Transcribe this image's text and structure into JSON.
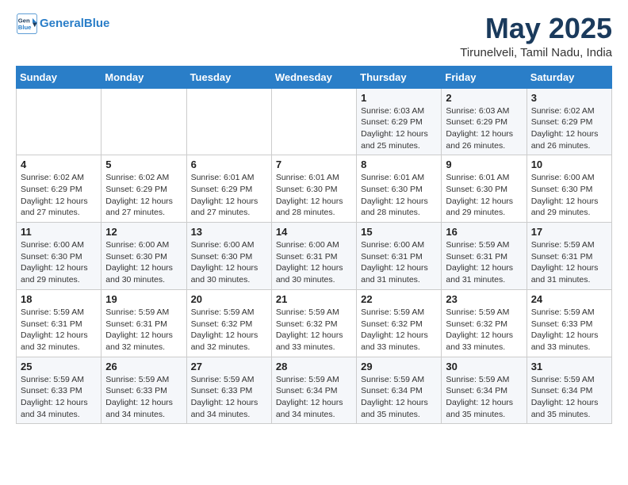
{
  "header": {
    "logo_line1": "General",
    "logo_line2": "Blue",
    "title": "May 2025",
    "subtitle": "Tirunelveli, Tamil Nadu, India"
  },
  "days_of_week": [
    "Sunday",
    "Monday",
    "Tuesday",
    "Wednesday",
    "Thursday",
    "Friday",
    "Saturday"
  ],
  "weeks": [
    [
      {
        "day": "",
        "info": ""
      },
      {
        "day": "",
        "info": ""
      },
      {
        "day": "",
        "info": ""
      },
      {
        "day": "",
        "info": ""
      },
      {
        "day": "1",
        "info": "Sunrise: 6:03 AM\nSunset: 6:29 PM\nDaylight: 12 hours\nand 25 minutes."
      },
      {
        "day": "2",
        "info": "Sunrise: 6:03 AM\nSunset: 6:29 PM\nDaylight: 12 hours\nand 26 minutes."
      },
      {
        "day": "3",
        "info": "Sunrise: 6:02 AM\nSunset: 6:29 PM\nDaylight: 12 hours\nand 26 minutes."
      }
    ],
    [
      {
        "day": "4",
        "info": "Sunrise: 6:02 AM\nSunset: 6:29 PM\nDaylight: 12 hours\nand 27 minutes."
      },
      {
        "day": "5",
        "info": "Sunrise: 6:02 AM\nSunset: 6:29 PM\nDaylight: 12 hours\nand 27 minutes."
      },
      {
        "day": "6",
        "info": "Sunrise: 6:01 AM\nSunset: 6:29 PM\nDaylight: 12 hours\nand 27 minutes."
      },
      {
        "day": "7",
        "info": "Sunrise: 6:01 AM\nSunset: 6:30 PM\nDaylight: 12 hours\nand 28 minutes."
      },
      {
        "day": "8",
        "info": "Sunrise: 6:01 AM\nSunset: 6:30 PM\nDaylight: 12 hours\nand 28 minutes."
      },
      {
        "day": "9",
        "info": "Sunrise: 6:01 AM\nSunset: 6:30 PM\nDaylight: 12 hours\nand 29 minutes."
      },
      {
        "day": "10",
        "info": "Sunrise: 6:00 AM\nSunset: 6:30 PM\nDaylight: 12 hours\nand 29 minutes."
      }
    ],
    [
      {
        "day": "11",
        "info": "Sunrise: 6:00 AM\nSunset: 6:30 PM\nDaylight: 12 hours\nand 29 minutes."
      },
      {
        "day": "12",
        "info": "Sunrise: 6:00 AM\nSunset: 6:30 PM\nDaylight: 12 hours\nand 30 minutes."
      },
      {
        "day": "13",
        "info": "Sunrise: 6:00 AM\nSunset: 6:30 PM\nDaylight: 12 hours\nand 30 minutes."
      },
      {
        "day": "14",
        "info": "Sunrise: 6:00 AM\nSunset: 6:31 PM\nDaylight: 12 hours\nand 30 minutes."
      },
      {
        "day": "15",
        "info": "Sunrise: 6:00 AM\nSunset: 6:31 PM\nDaylight: 12 hours\nand 31 minutes."
      },
      {
        "day": "16",
        "info": "Sunrise: 5:59 AM\nSunset: 6:31 PM\nDaylight: 12 hours\nand 31 minutes."
      },
      {
        "day": "17",
        "info": "Sunrise: 5:59 AM\nSunset: 6:31 PM\nDaylight: 12 hours\nand 31 minutes."
      }
    ],
    [
      {
        "day": "18",
        "info": "Sunrise: 5:59 AM\nSunset: 6:31 PM\nDaylight: 12 hours\nand 32 minutes."
      },
      {
        "day": "19",
        "info": "Sunrise: 5:59 AM\nSunset: 6:31 PM\nDaylight: 12 hours\nand 32 minutes."
      },
      {
        "day": "20",
        "info": "Sunrise: 5:59 AM\nSunset: 6:32 PM\nDaylight: 12 hours\nand 32 minutes."
      },
      {
        "day": "21",
        "info": "Sunrise: 5:59 AM\nSunset: 6:32 PM\nDaylight: 12 hours\nand 33 minutes."
      },
      {
        "day": "22",
        "info": "Sunrise: 5:59 AM\nSunset: 6:32 PM\nDaylight: 12 hours\nand 33 minutes."
      },
      {
        "day": "23",
        "info": "Sunrise: 5:59 AM\nSunset: 6:32 PM\nDaylight: 12 hours\nand 33 minutes."
      },
      {
        "day": "24",
        "info": "Sunrise: 5:59 AM\nSunset: 6:33 PM\nDaylight: 12 hours\nand 33 minutes."
      }
    ],
    [
      {
        "day": "25",
        "info": "Sunrise: 5:59 AM\nSunset: 6:33 PM\nDaylight: 12 hours\nand 34 minutes."
      },
      {
        "day": "26",
        "info": "Sunrise: 5:59 AM\nSunset: 6:33 PM\nDaylight: 12 hours\nand 34 minutes."
      },
      {
        "day": "27",
        "info": "Sunrise: 5:59 AM\nSunset: 6:33 PM\nDaylight: 12 hours\nand 34 minutes."
      },
      {
        "day": "28",
        "info": "Sunrise: 5:59 AM\nSunset: 6:34 PM\nDaylight: 12 hours\nand 34 minutes."
      },
      {
        "day": "29",
        "info": "Sunrise: 5:59 AM\nSunset: 6:34 PM\nDaylight: 12 hours\nand 35 minutes."
      },
      {
        "day": "30",
        "info": "Sunrise: 5:59 AM\nSunset: 6:34 PM\nDaylight: 12 hours\nand 35 minutes."
      },
      {
        "day": "31",
        "info": "Sunrise: 5:59 AM\nSunset: 6:34 PM\nDaylight: 12 hours\nand 35 minutes."
      }
    ]
  ]
}
